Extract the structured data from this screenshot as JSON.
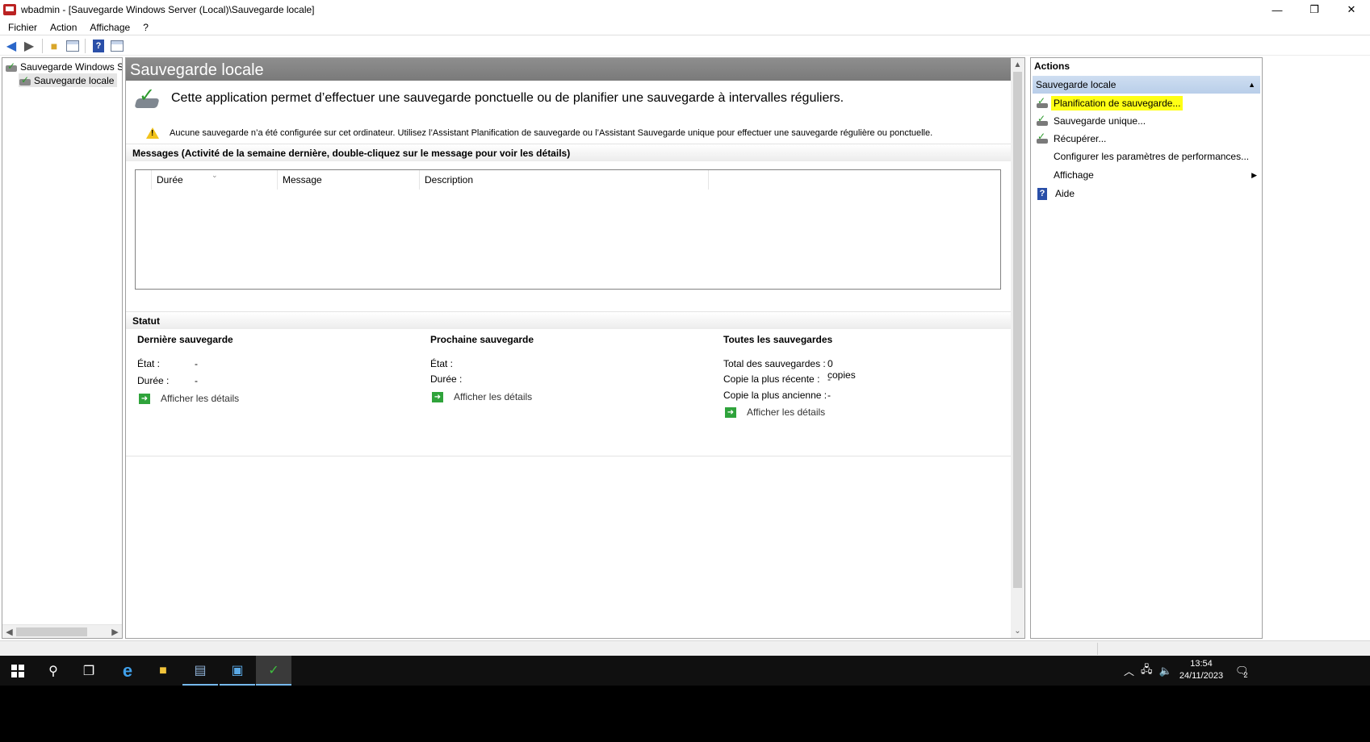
{
  "window": {
    "title": "wbadmin - [Sauvegarde Windows Server (Local)\\Sauvegarde locale]",
    "minimize": "—",
    "restore": "❐",
    "close": "✕"
  },
  "menu": [
    "Fichier",
    "Action",
    "Affichage",
    "?"
  ],
  "tree": {
    "root_label": "Sauvegarde Windows Serv",
    "child_label": "Sauvegarde locale"
  },
  "center": {
    "header": "Sauvegarde locale",
    "intro": "Cette application permet d’effectuer une sauvegarde ponctuelle ou de planifier une sauvegarde à intervalles réguliers.",
    "warning": "Aucune sauvegarde n’a été configurée sur cet ordinateur. Utilisez l’Assistant Planification de sauvegarde ou l’Assistant Sauvegarde unique pour effectuer une sauvegarde régulière ou ponctuelle.",
    "messages_header": "Messages (Activité de la semaine dernière, double-cliquez sur le message pour voir les détails)",
    "columns": [
      "Durée",
      "Message",
      "Description"
    ],
    "status_header": "Statut",
    "last": {
      "title": "Dernière sauvegarde",
      "state_label": "État :",
      "state_value": "-",
      "duration_label": "Durée :",
      "duration_value": "-",
      "details": "Afficher les détails"
    },
    "next": {
      "title": "Prochaine sauvegarde",
      "state_label": "État :",
      "duration_label": "Durée :",
      "details": "Afficher les détails"
    },
    "all": {
      "title": "Toutes les sauvegardes",
      "total_label": "Total des sauvegardes :",
      "total_value": "0 copies",
      "recent_label": "Copie la plus récente :",
      "recent_value": "-",
      "oldest_label": "Copie la plus ancienne :",
      "oldest_value": "-",
      "details": "Afficher les détails"
    }
  },
  "actions": {
    "title": "Actions",
    "group": "Sauvegarde locale",
    "items": [
      "Planification de sauvegarde...",
      "Sauvegarde unique...",
      "Récupérer...",
      "Configurer les paramètres de performances...",
      "Affichage",
      "Aide"
    ],
    "highlight_color": "#ffff14"
  },
  "taskbar": {
    "time": "13:54",
    "date": "24/11/2023",
    "notification_count": "2"
  }
}
